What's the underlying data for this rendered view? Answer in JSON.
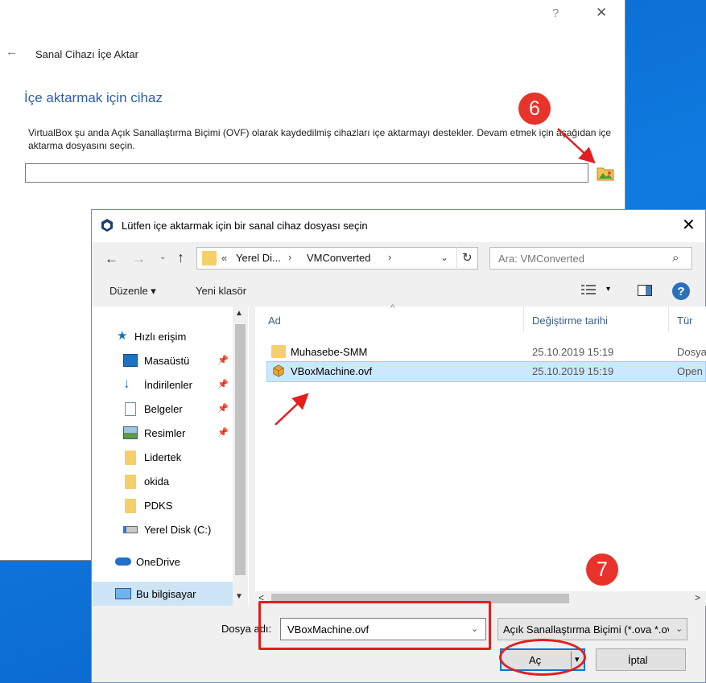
{
  "wizard": {
    "help_glyph": "?",
    "close_glyph": "✕",
    "back_glyph": "←",
    "title": "Sanal Cihazı İçe Aktar",
    "heading": "İçe aktarmak için cihaz",
    "description": "VirtualBox şu anda Açık Sanallaştırma Biçimi (OVF) olarak kaydedilmiş cihazları içe aktarmayı destekler. Devam etmek için aşağıdan içe aktarma dosyasını seçin.",
    "file_path_value": "",
    "browse_icon": "folder-browse-icon"
  },
  "markers": {
    "step6": "6",
    "step7": "7"
  },
  "dialog": {
    "title": "Lütfen içe aktarmak için bir sanal cihaz dosyası seçin",
    "close_glyph": "✕",
    "nav": {
      "back": "←",
      "forward": "→",
      "recent": "⌄",
      "up": "↑"
    },
    "address": {
      "prefix": "«",
      "crumbs": [
        "Yerel Di...",
        "VMConverted"
      ],
      "separator": "›",
      "dropdown": "⌄",
      "refresh": "↻"
    },
    "search": {
      "placeholder": "Ara: VMConverted",
      "icon": "⌕"
    },
    "toolbar": {
      "organize": "Düzenle ▾",
      "new_folder": "Yeni klasör",
      "view_caret": "▾",
      "help": "?"
    },
    "nav_pane": {
      "items": [
        {
          "label": "Hızlı erişim",
          "icon": "star-icon",
          "pinned": false
        },
        {
          "label": "Masaüstü",
          "icon": "desktop-icon",
          "pinned": true
        },
        {
          "label": "İndirilenler",
          "icon": "download-icon",
          "pinned": true
        },
        {
          "label": "Belgeler",
          "icon": "documents-icon",
          "pinned": true
        },
        {
          "label": "Resimler",
          "icon": "pictures-icon",
          "pinned": true
        },
        {
          "label": "Lidertek",
          "icon": "folder-icon",
          "pinned": false
        },
        {
          "label": "okida",
          "icon": "folder-icon",
          "pinned": false
        },
        {
          "label": "PDKS",
          "icon": "folder-icon",
          "pinned": false
        },
        {
          "label": "Yerel Disk (C:)",
          "icon": "drive-icon",
          "pinned": false
        },
        {
          "label": "OneDrive",
          "icon": "cloud-icon",
          "pinned": false
        },
        {
          "label": "Bu bilgisayar",
          "icon": "computer-icon",
          "pinned": false
        }
      ],
      "pin_glyph": "📌",
      "scroll_up": "▲",
      "scroll_down": "▼"
    },
    "columns": {
      "name": "Ad",
      "modified": "Değiştirme tarihi",
      "type": "Tür",
      "sort": "^"
    },
    "files": [
      {
        "name": "Muhasebe-SMM",
        "modified": "25.10.2019 15:19",
        "type": "Dosya",
        "icon": "folder-icon",
        "selected": false
      },
      {
        "name": "VBoxMachine.ovf",
        "modified": "25.10.2019 15:19",
        "type": "Open",
        "icon": "virtualbox-package-icon",
        "selected": true
      }
    ],
    "hscroll": {
      "left": "<",
      "right": ">"
    },
    "filename_label": "Dosya adı:",
    "filename_value": "VBoxMachine.ovf",
    "filename_caret": "⌄",
    "filter_value": "Açık Sanallaştırma Biçimi (*.ova *.ovf)",
    "filter_caret": "⌄",
    "open_label": "Aç",
    "open_caret": "▾",
    "cancel_label": "İptal"
  },
  "colors": {
    "accent": "#0078d7",
    "marker": "#e8332a",
    "annotation": "#e31e1e",
    "heading": "#2a5fae"
  }
}
